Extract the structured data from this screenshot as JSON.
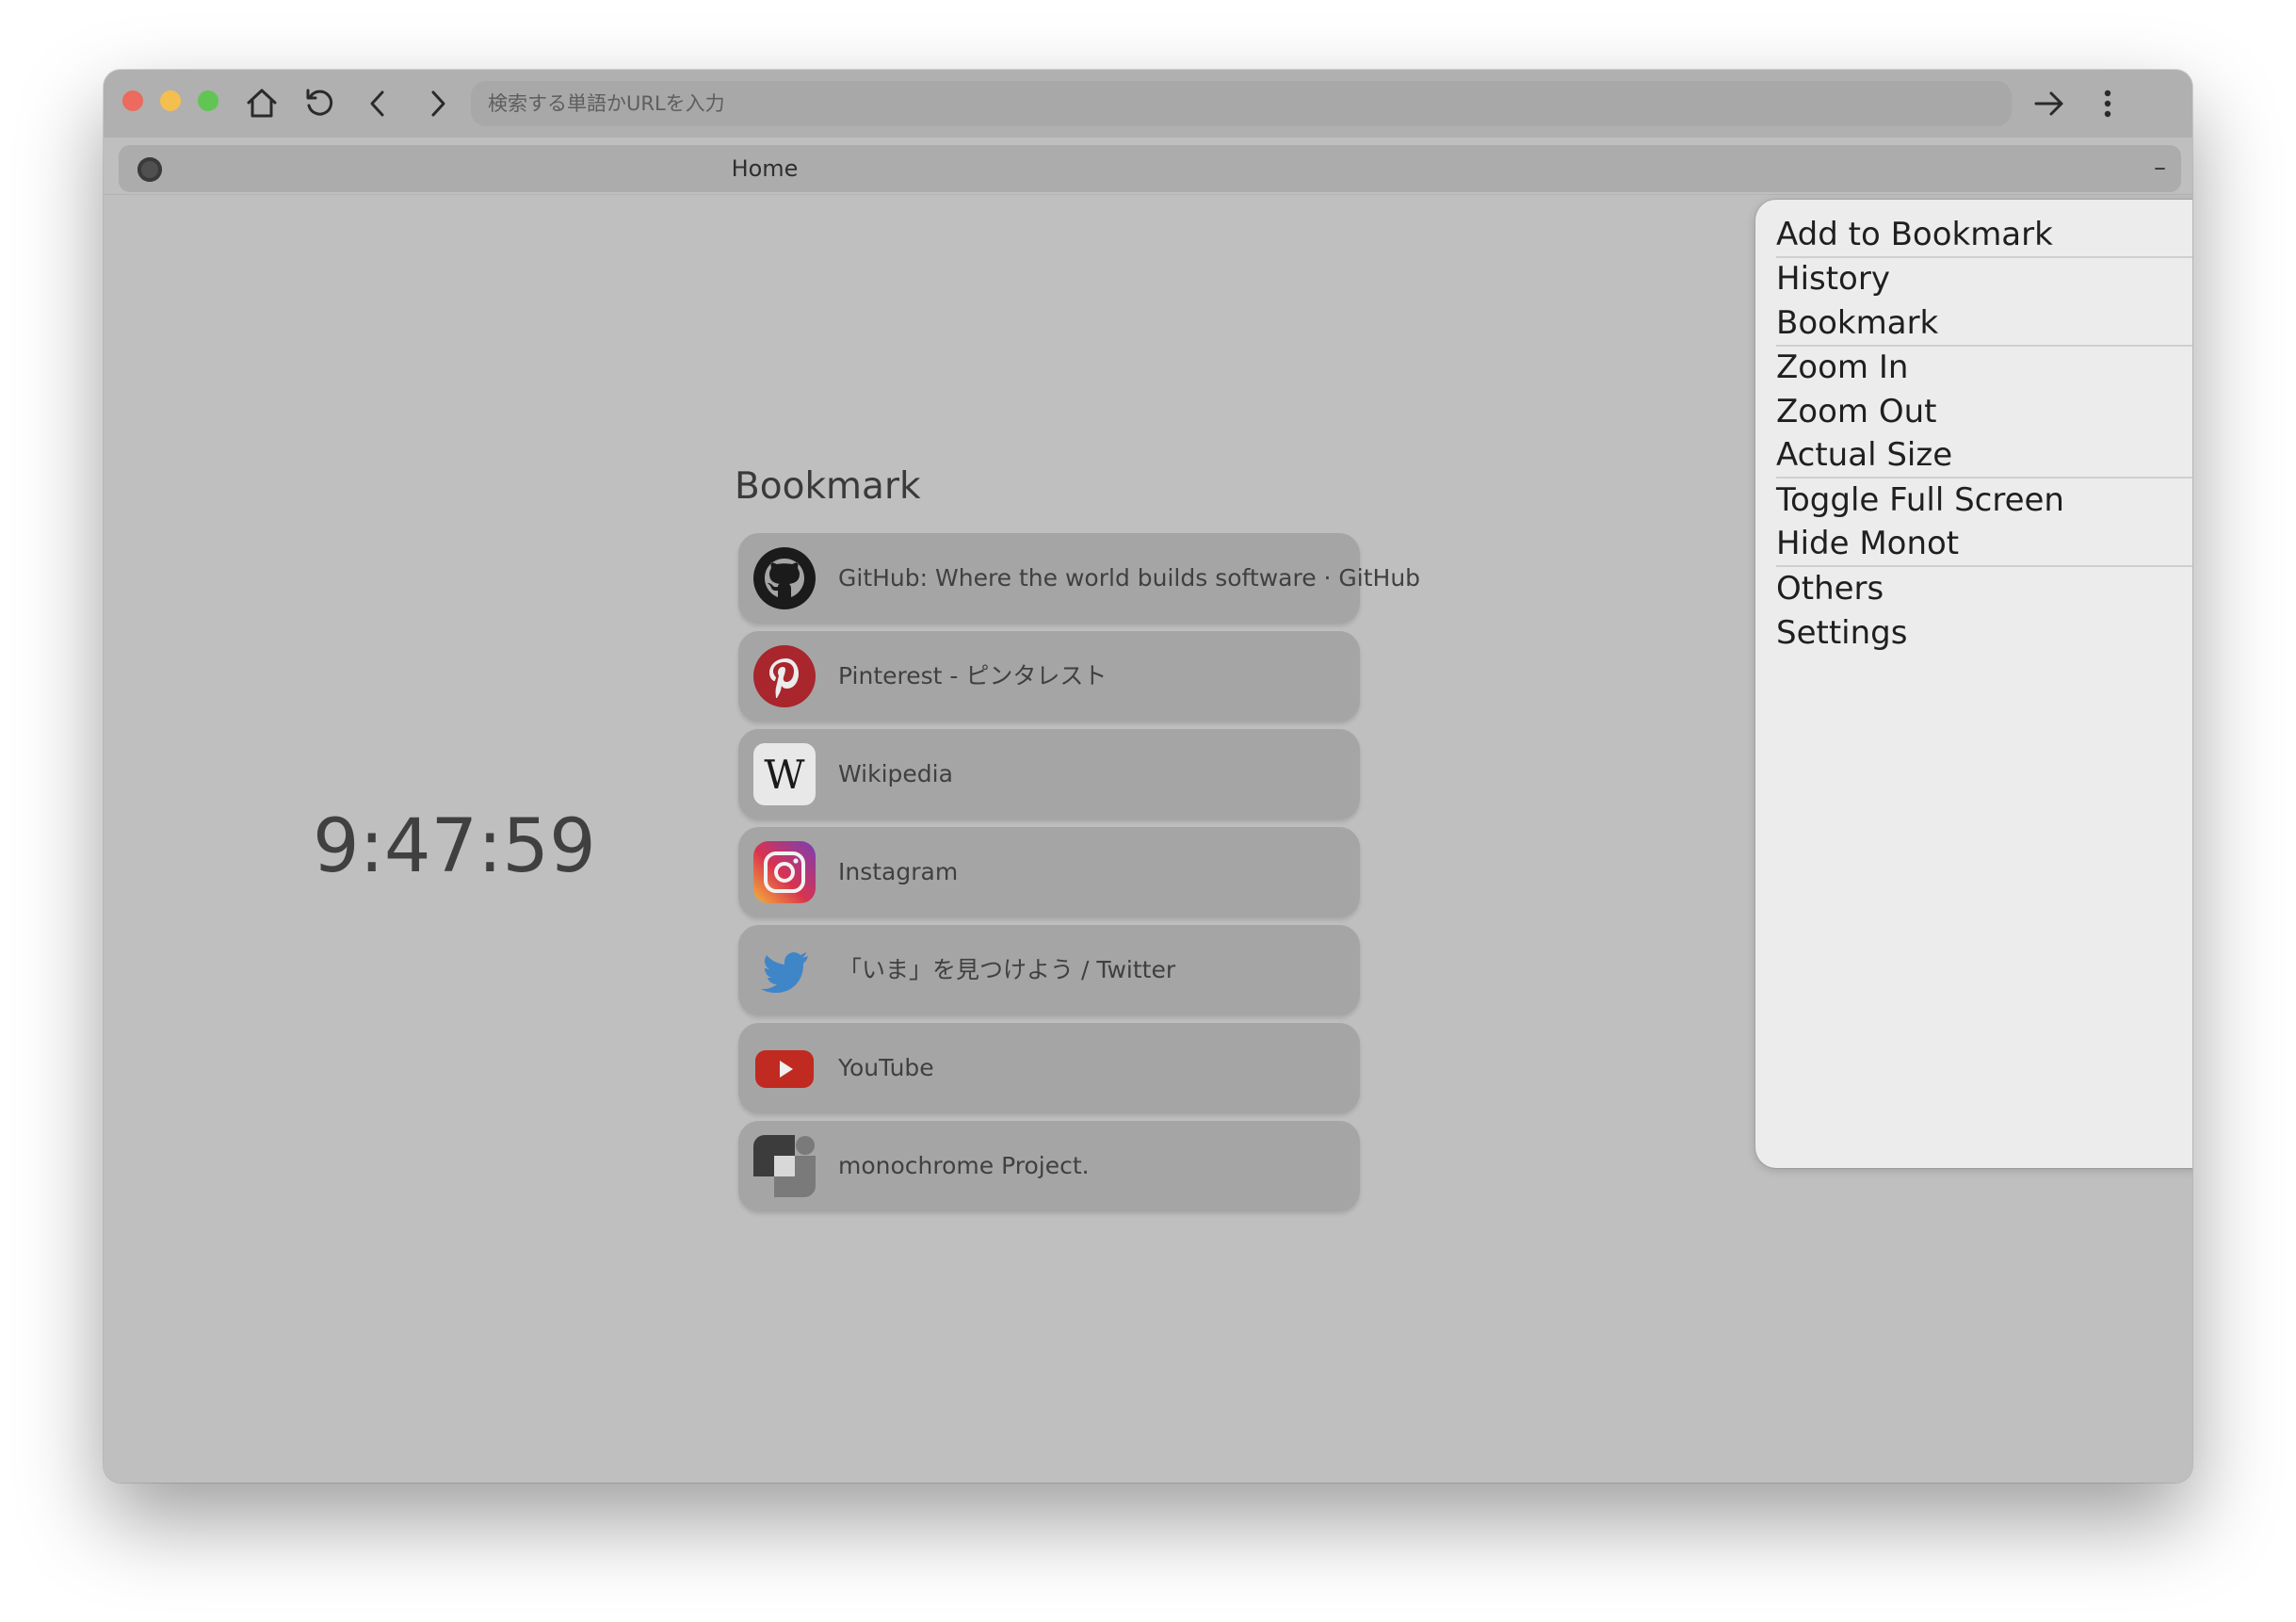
{
  "toolbar": {
    "search_placeholder": "検索する単語かURLを入力",
    "icons": [
      "home-icon",
      "reload-icon",
      "back-icon",
      "forward-icon",
      "go-arrow-icon",
      "more-vertical-icon"
    ]
  },
  "tab": {
    "title": "Home",
    "close_label": "–"
  },
  "clock": {
    "time": "9:47:59"
  },
  "bookmarks": {
    "heading": "Bookmark",
    "items": [
      {
        "title": "GitHub: Where the world builds software · GitHub",
        "icon": "github-icon"
      },
      {
        "title": "Pinterest - ピンタレスト",
        "icon": "pinterest-icon"
      },
      {
        "title": "Wikipedia",
        "icon": "wikipedia-icon"
      },
      {
        "title": "Instagram",
        "icon": "instagram-icon"
      },
      {
        "title": "「いま」を見つけよう / Twitter",
        "icon": "twitter-icon"
      },
      {
        "title": "YouTube",
        "icon": "youtube-icon"
      },
      {
        "title": "monochrome Project.",
        "icon": "monochrome-project-icon"
      }
    ]
  },
  "menu": {
    "items": [
      {
        "label": "Add to Bookmark",
        "submenu": false
      },
      {
        "label": "History",
        "submenu": true
      },
      {
        "label": "Bookmark",
        "submenu": true
      },
      {
        "label": "Zoom In",
        "submenu": false
      },
      {
        "label": "Zoom Out",
        "submenu": false
      },
      {
        "label": "Actual Size",
        "submenu": false
      },
      {
        "label": "Toggle Full Screen",
        "submenu": false
      },
      {
        "label": "Hide Monot",
        "submenu": false
      },
      {
        "label": "Others",
        "submenu": true
      },
      {
        "label": "Settings",
        "submenu": false
      }
    ]
  },
  "colors": {
    "window_bg": "#bfbfbf",
    "toolbar_bg": "#b0b0b0",
    "menu_bg": "#ececec",
    "bookmark_card_bg": "#a5a5a5"
  }
}
